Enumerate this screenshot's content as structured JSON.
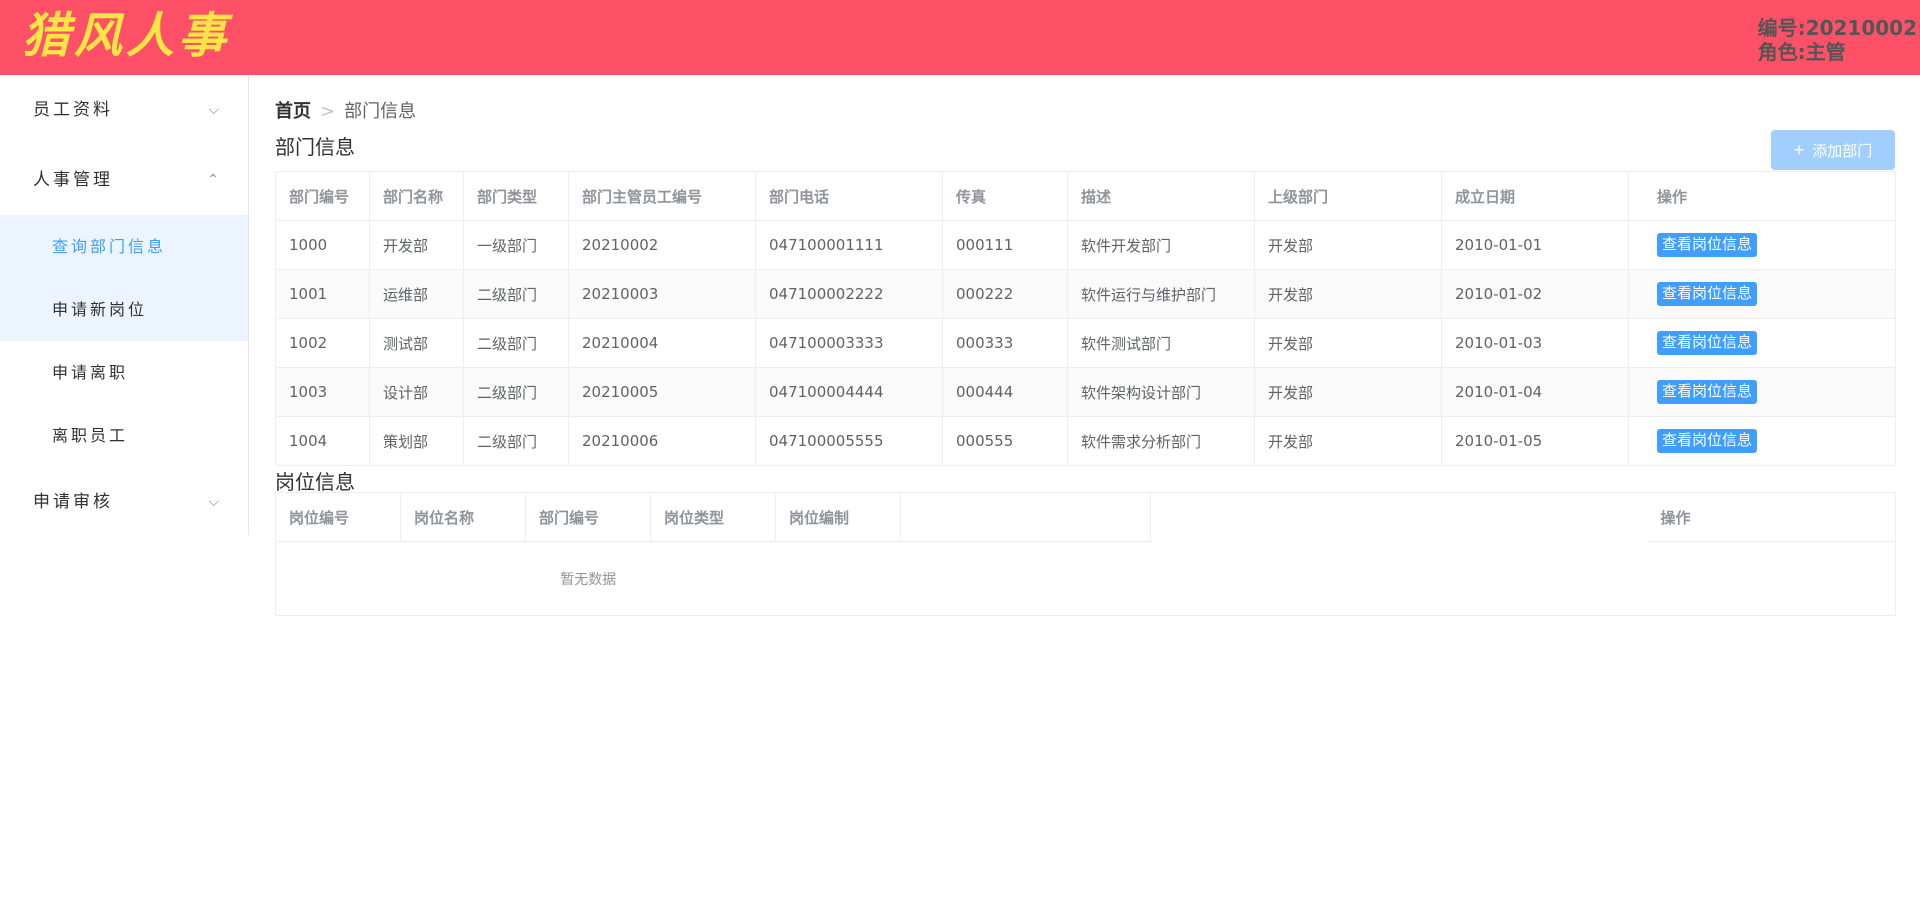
{
  "header": {
    "logo": "猎风人事",
    "user_id": "编号:20210002",
    "role": "角色:主管"
  },
  "colors": {
    "header_bg": "#fe5067",
    "logo": "#fde543",
    "primary": "#409eff",
    "disabled_primary": "#a0cfff"
  },
  "sidebar": {
    "groups": [
      {
        "label": "员工资料",
        "icon": "chevron-down-icon",
        "expanded": false
      },
      {
        "label": "人事管理",
        "icon": "chevron-up-icon",
        "expanded": true,
        "items": [
          {
            "label": "查询部门信息",
            "active": true
          },
          {
            "label": "申请新岗位",
            "active": false
          },
          {
            "label": "申请离职",
            "active": false
          },
          {
            "label": "离职员工",
            "active": false
          }
        ]
      },
      {
        "label": "申请审核",
        "icon": "chevron-down-icon",
        "expanded": false
      }
    ]
  },
  "breadcrumb": {
    "home": "首页",
    "separator": ">",
    "current": "部门信息"
  },
  "dept_section": {
    "title": "部门信息",
    "add_button": "添加部门",
    "columns": [
      "部门编号",
      "部门名称",
      "部门类型",
      "部门主管员工编号",
      "部门电话",
      "传真",
      "描述",
      "上级部门",
      "成立日期",
      "操作"
    ],
    "action_label": "查看岗位信息",
    "rows": [
      [
        "1000",
        "开发部",
        "一级部门",
        "20210002",
        "047100001111",
        "000111",
        "软件开发部门",
        "开发部",
        "2010-01-01"
      ],
      [
        "1001",
        "运维部",
        "二级部门",
        "20210003",
        "047100002222",
        "000222",
        "软件运行与维护部门",
        "开发部",
        "2010-01-02"
      ],
      [
        "1002",
        "测试部",
        "二级部门",
        "20210004",
        "047100003333",
        "000333",
        "软件测试部门",
        "开发部",
        "2010-01-03"
      ],
      [
        "1003",
        "设计部",
        "二级部门",
        "20210005",
        "047100004444",
        "000444",
        "软件架构设计部门",
        "开发部",
        "2010-01-04"
      ],
      [
        "1004",
        "策划部",
        "二级部门",
        "20210006",
        "047100005555",
        "000555",
        "软件需求分析部门",
        "开发部",
        "2010-01-05"
      ]
    ]
  },
  "post_section": {
    "title": "岗位信息",
    "columns": [
      "岗位编号",
      "岗位名称",
      "部门编号",
      "岗位类型",
      "岗位编制"
    ],
    "action_column": "操作",
    "empty_text": "暂无数据"
  }
}
